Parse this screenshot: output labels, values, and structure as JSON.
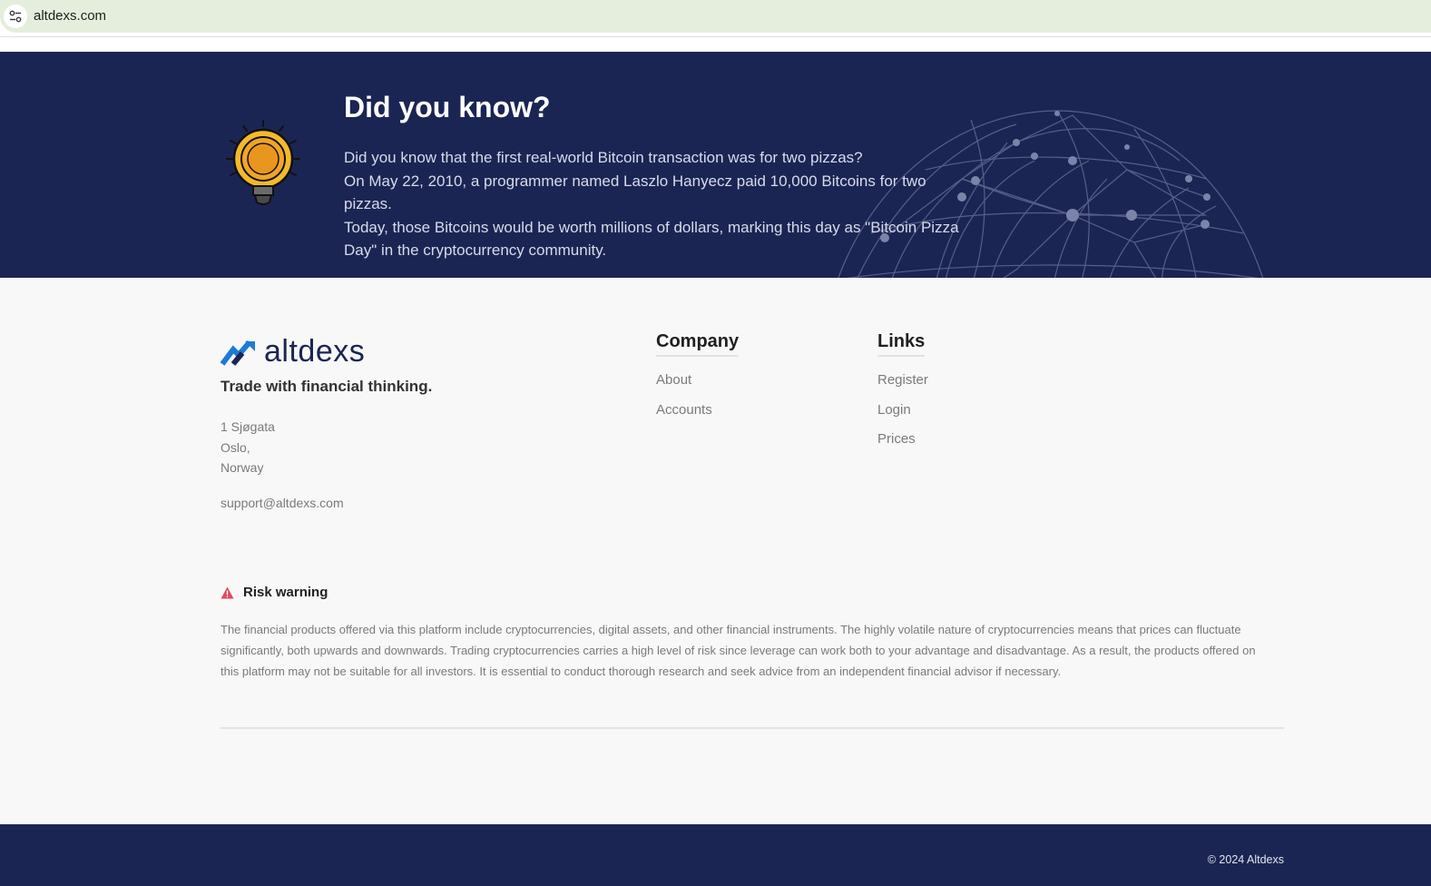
{
  "browser": {
    "url": "altdexs.com",
    "site_info_icon": "tune-icon"
  },
  "banner": {
    "title": "Did you know?",
    "icon": "lightbulb-coin-icon",
    "lines": [
      "Did you know that the first real-world Bitcoin transaction was for two pizzas?",
      "On May 22, 2010, a programmer named Laszlo Hanyecz paid 10,000 Bitcoins for two pizzas.",
      "Today, those Bitcoins would be worth millions of dollars, marking this day as \"Bitcoin Pizza Day\" in the cryptocurrency community."
    ],
    "colors": {
      "background": "#1b2554",
      "text": "#d7dbe8"
    }
  },
  "footer": {
    "brand": "altdexs",
    "tagline": "Trade with financial thinking.",
    "address": [
      "1 Sjøgata",
      "Oslo,",
      "Norway"
    ],
    "email": "support@altdexs.com",
    "company": {
      "title": "Company",
      "items": [
        "About",
        "Accounts"
      ]
    },
    "links": {
      "title": "Links",
      "items": [
        "Register",
        "Login",
        "Prices"
      ]
    },
    "risk": {
      "title": "Risk warning",
      "icon": "warning-icon",
      "text": "The financial products offered via this platform include cryptocurrencies, digital assets, and other financial instruments. The highly volatile nature of cryptocurrencies means that prices can fluctuate significantly, both upwards and downwards. Trading cryptocurrencies carries a high level of risk since leverage can work both to your advantage and disadvantage. As a result, the products offered on this platform may not be suitable for all investors. It is essential to conduct thorough research and seek advice from an independent financial advisor if necessary."
    },
    "copyright": "© 2024 Altdexs",
    "colors": {
      "brand": "#1b2554",
      "logo_accent": "#1d7ad8",
      "warning": "#e0475f"
    }
  }
}
